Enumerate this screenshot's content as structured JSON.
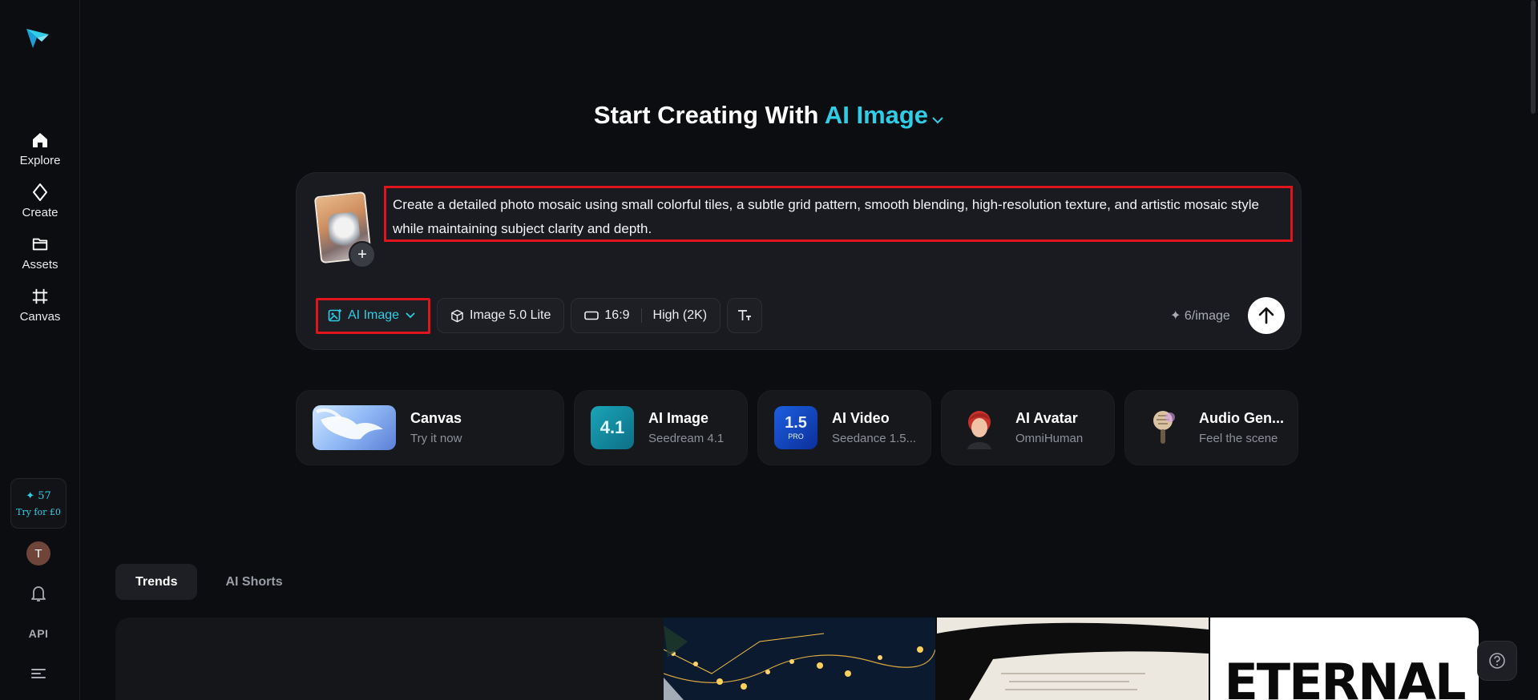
{
  "sidebar": {
    "items": [
      {
        "label": "Explore",
        "icon": "home-icon"
      },
      {
        "label": "Create",
        "icon": "sparkle-icon"
      },
      {
        "label": "Assets",
        "icon": "folder-icon"
      },
      {
        "label": "Canvas",
        "icon": "crop-frame-icon"
      }
    ],
    "credits": {
      "amount": "✦ 57",
      "try_label": "Try for £0"
    },
    "avatar_initial": "T",
    "api_label": "API"
  },
  "hero": {
    "prefix": "Start Creating With",
    "accent": "AI Image"
  },
  "composer": {
    "prompt": "Create a detailed photo mosaic using small colorful tiles, a subtle grid pattern, smooth blending, high-resolution texture, and artistic mosaic style while maintaining subject clarity and depth.",
    "add_label": "+",
    "mode_label": "AI Image",
    "model_label": "Image 5.0 Lite",
    "ratio_label": "16:9",
    "quality_label": "High (2K)",
    "cost_label": "✦ 6/image"
  },
  "cards": [
    {
      "title": "Canvas",
      "subtitle": "Try it now"
    },
    {
      "title": "AI Image",
      "subtitle": "Seedream 4.1",
      "badge": "4.1"
    },
    {
      "title": "AI Video",
      "subtitle": "Seedance 1.5...",
      "badge": "1.5",
      "badge2": "PRO"
    },
    {
      "title": "AI Avatar",
      "subtitle": "OmniHuman"
    },
    {
      "title": "Audio Gen...",
      "subtitle": "Feel the scene"
    }
  ],
  "tabs": [
    {
      "label": "Trends",
      "active": true
    },
    {
      "label": "AI Shorts",
      "active": false
    }
  ],
  "gallery": {
    "eternal_text": "ETERNAL"
  },
  "colors": {
    "accent": "#2fcde6",
    "highlight": "#e0141c",
    "background": "#0c0d10",
    "panel": "#1a1b20"
  }
}
